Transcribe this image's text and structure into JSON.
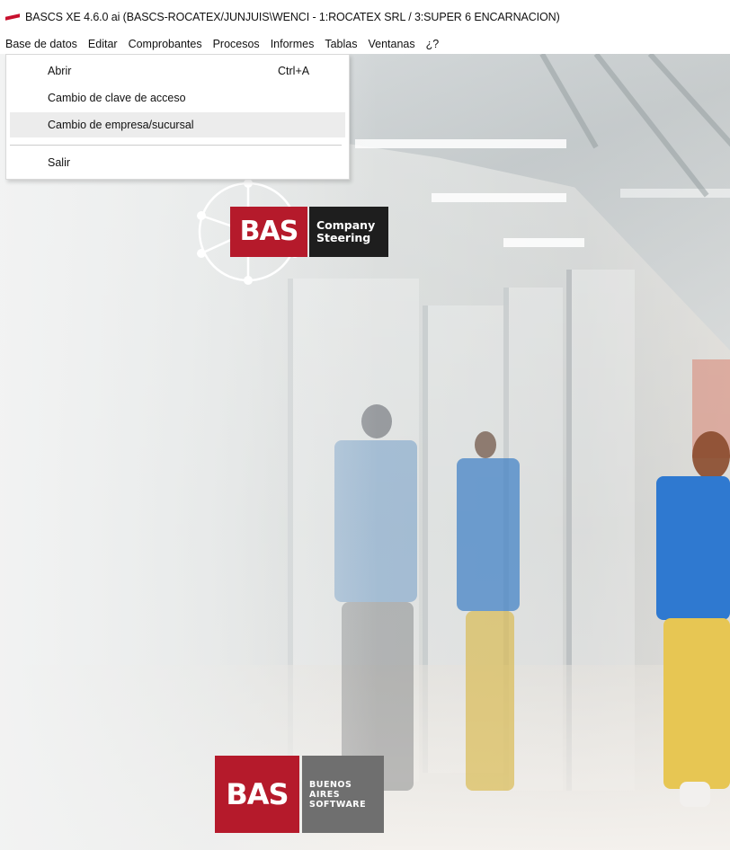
{
  "window": {
    "title": "BASCS XE 4.6.0 ai (BASCS-ROCATEX/JUNJUIS\\WENCI - 1:ROCATEX SRL / 3:SUPER 6 ENCARNACION)",
    "icon": "bas-app-icon"
  },
  "menubar": {
    "items": [
      {
        "label": "Base de datos"
      },
      {
        "label": "Editar"
      },
      {
        "label": "Comprobantes"
      },
      {
        "label": "Procesos"
      },
      {
        "label": "Informes"
      },
      {
        "label": "Tablas"
      },
      {
        "label": "Ventanas"
      },
      {
        "label": "¿?"
      }
    ]
  },
  "dropdown": {
    "items": [
      {
        "label": "Abrir",
        "shortcut": "Ctrl+A"
      },
      {
        "label": "Cambio de clave de acceso",
        "shortcut": ""
      },
      {
        "label": "Cambio de empresa/sucursal",
        "shortcut": "",
        "highlighted": true
      },
      {
        "label": "Salir",
        "shortcut": ""
      }
    ]
  },
  "logos": {
    "steering": {
      "brand": "BAS",
      "line1": "Company",
      "line2": "Steering"
    },
    "footer": {
      "brand": "BAS",
      "line1": "BUENOS",
      "line2": "AIRES",
      "line3": "SOFTWARE"
    }
  },
  "colors": {
    "brand_red": "#b51a2b",
    "menu_highlight": "#ececec"
  }
}
